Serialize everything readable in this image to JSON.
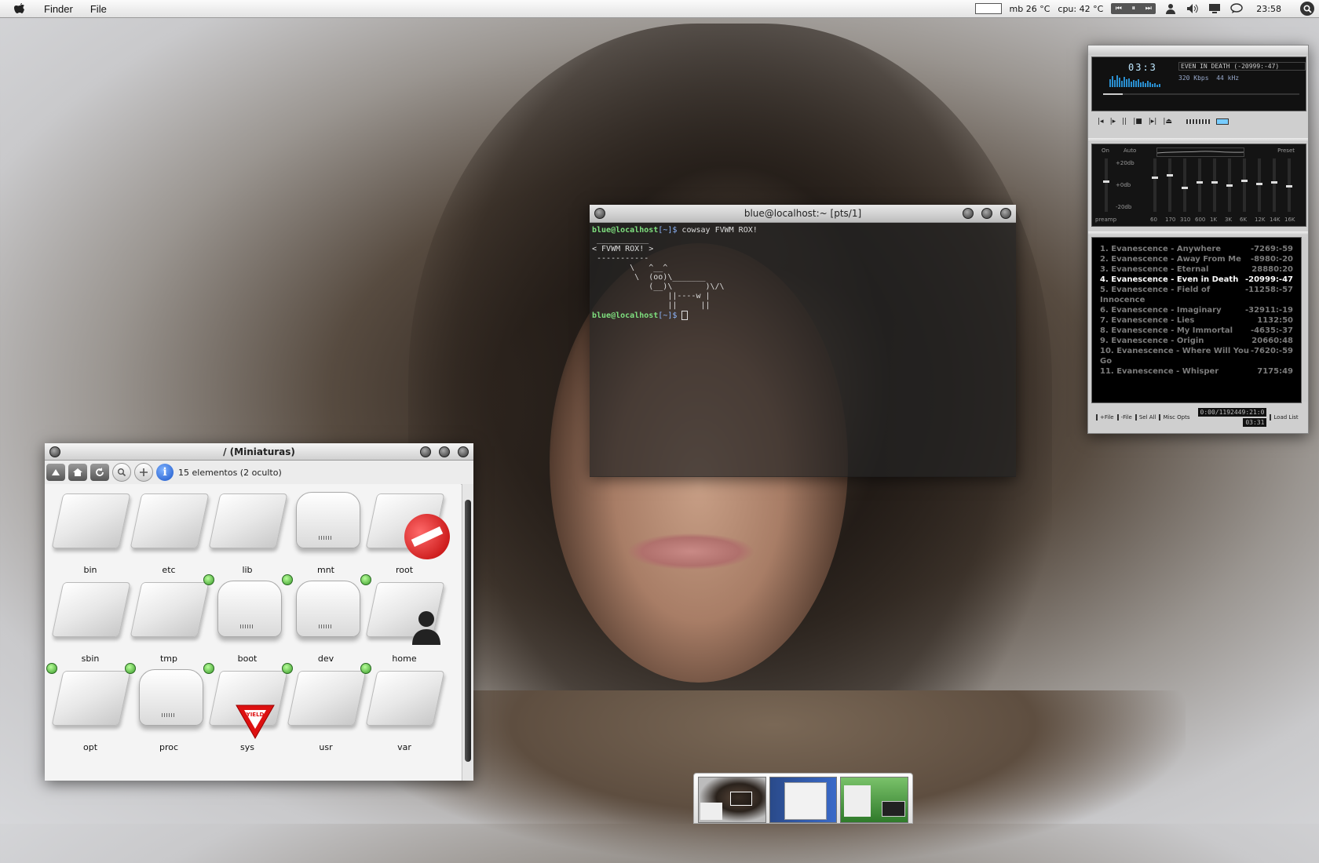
{
  "menubar": {
    "app_name": "Finder",
    "menus": [
      "File"
    ],
    "status_mb": "mb 26 °C",
    "status_cpu": "cpu: 42 °C",
    "clock": "23:58",
    "media_controls": [
      "⏮",
      "⏸",
      "⏭"
    ]
  },
  "terminal": {
    "title": "blue@localhost:~ [pts/1]",
    "prompt_user": "blue@localhost",
    "prompt_dir": "[~]$",
    "command": "cowsay FVWM ROX!",
    "cowsay_output": " ___________\n< FVWM ROX! >\n -----------\n        \\   ^__^\n         \\  (oo)\\_______\n            (__)\\       )\\/\\\n                ||----w |\n                ||     ||"
  },
  "finder": {
    "title": "/ (Miniaturas)",
    "status": "15 elementos (2 oculto)",
    "items": [
      {
        "name": "bin",
        "kind": "folder",
        "mounted": false
      },
      {
        "name": "etc",
        "kind": "folder",
        "mounted": false
      },
      {
        "name": "lib",
        "kind": "folder",
        "mounted": false
      },
      {
        "name": "mnt",
        "kind": "drive",
        "mounted": false
      },
      {
        "name": "root",
        "kind": "folder-locked",
        "mounted": false
      },
      {
        "name": "sbin",
        "kind": "folder",
        "mounted": false
      },
      {
        "name": "tmp",
        "kind": "folder",
        "mounted": false
      },
      {
        "name": "boot",
        "kind": "drive",
        "mounted": true
      },
      {
        "name": "dev",
        "kind": "drive",
        "mounted": true
      },
      {
        "name": "home",
        "kind": "folder-user",
        "mounted": true
      },
      {
        "name": "opt",
        "kind": "folder",
        "mounted": true
      },
      {
        "name": "proc",
        "kind": "drive",
        "mounted": true
      },
      {
        "name": "sys",
        "kind": "folder-yield",
        "mounted": true
      },
      {
        "name": "usr",
        "kind": "folder",
        "mounted": true
      },
      {
        "name": "var",
        "kind": "folder",
        "mounted": true
      }
    ],
    "yield_text": "YIELD"
  },
  "xmms": {
    "time": "03:3",
    "song_title": "EVEN IN DEATH (-20999:-47)",
    "kbps": "320",
    "kbps_unit": "Kbps",
    "khz": "44",
    "khz_unit": "kHz",
    "eq": {
      "on_label": "On",
      "auto_label": "Auto",
      "preset_label": "Preset",
      "db_labels": [
        "+20db",
        "+0db",
        "-20db"
      ],
      "preamp_label": "preamp",
      "bands": [
        "60",
        "170",
        "310",
        "600",
        "1K",
        "3K",
        "6K",
        "12K",
        "14K",
        "16K"
      ],
      "band_levels": [
        0.35,
        0.3,
        0.55,
        0.45,
        0.45,
        0.5,
        0.42,
        0.48,
        0.45,
        0.52
      ]
    },
    "playlist": [
      {
        "title": "1. Evanescence - Anywhere",
        "time": "-7269:-59"
      },
      {
        "title": "2. Evanescence - Away From Me",
        "time": "-8980:-20"
      },
      {
        "title": "3. Evanescence - Eternal",
        "time": "28880:20"
      },
      {
        "title": "4. Evanescence - Even in Death",
        "time": "-20999:-47"
      },
      {
        "title": "5. Evanescence - Field of Innocence",
        "time": "-11258:-57"
      },
      {
        "title": "6. Evanescence - Imaginary",
        "time": "-32911:-19"
      },
      {
        "title": "7. Evanescence - Lies",
        "time": "1132:50"
      },
      {
        "title": "8. Evanescence - My Immortal",
        "time": "-4635:-37"
      },
      {
        "title": "9. Evanescence - Origin",
        "time": "20660:48"
      },
      {
        "title": "10. Evanescence - Where Will You Go",
        "time": "-7620:-59"
      },
      {
        "title": "11. Evanescence - Whisper",
        "time": "7175:49"
      }
    ],
    "current_index": 3,
    "pl_buttons": [
      "+File",
      "-File",
      "Sel All",
      "Misc Opts",
      "Load List"
    ],
    "pl_time": "0:00/1192449:21:0",
    "pl_time2": "03:31"
  }
}
